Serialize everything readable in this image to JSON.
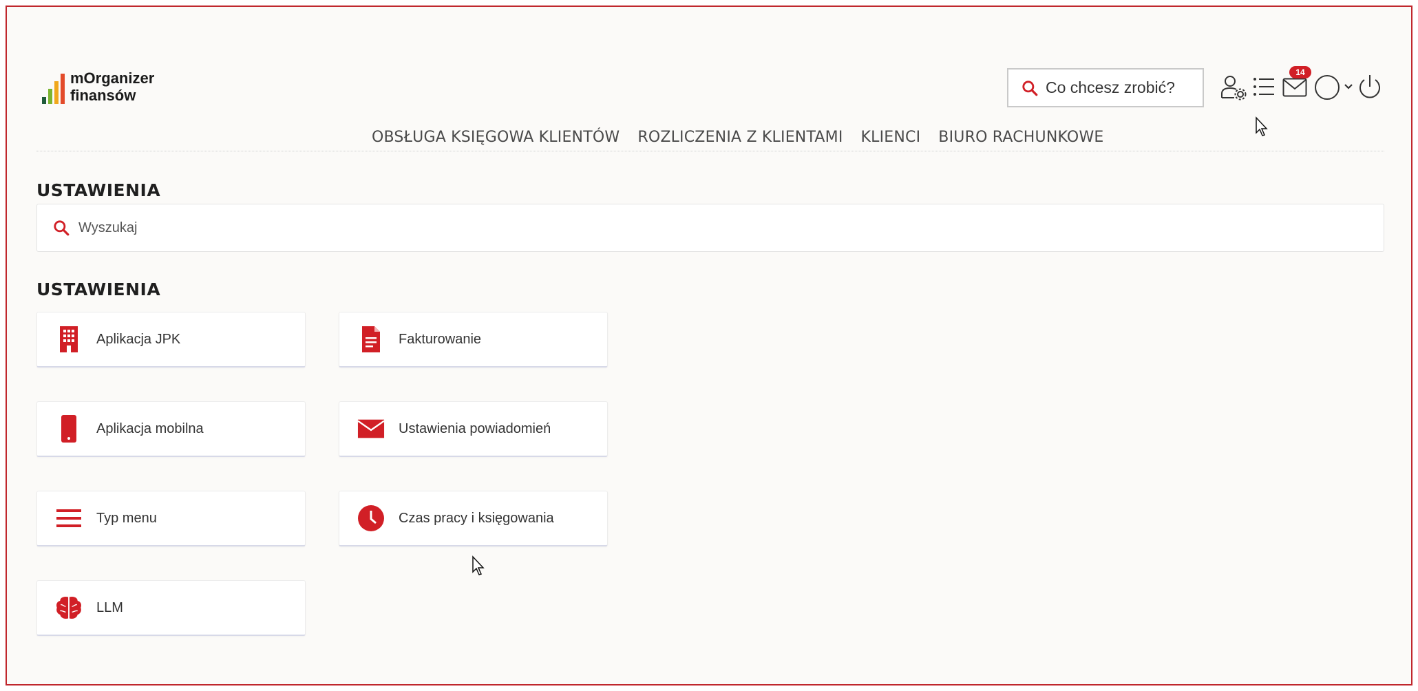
{
  "brand": {
    "line1": "mOrganizer",
    "line2": "finansów"
  },
  "header": {
    "quick_search": "Co chcesz zrobić?",
    "notifications_count": "14"
  },
  "nav": {
    "items": [
      {
        "label": "OBSŁUGA KSIĘGOWA KLIENTÓW"
      },
      {
        "label": "ROZLICZENIA Z KLIENTAMI"
      },
      {
        "label": "KLIENCI"
      },
      {
        "label": "BIURO RACHUNKOWE"
      }
    ]
  },
  "page": {
    "title": "USTAWIENIA",
    "search_placeholder": "Wyszukaj",
    "section_title": "USTAWIENIA"
  },
  "tiles": [
    {
      "label": "Aplikacja JPK",
      "icon": "building-icon"
    },
    {
      "label": "Fakturowanie",
      "icon": "document-icon"
    },
    {
      "label": "Aplikacja mobilna",
      "icon": "phone-icon"
    },
    {
      "label": "Ustawienia powiadomień",
      "icon": "envelope-icon"
    },
    {
      "label": "Typ menu",
      "icon": "menu-icon"
    },
    {
      "label": "Czas pracy i księgowania",
      "icon": "clock-icon"
    },
    {
      "label": "LLM",
      "icon": "brain-icon"
    }
  ],
  "colors": {
    "accent": "#d11f26",
    "frame": "#c0272d",
    "logo_bars": [
      "#1f5b3a",
      "#7bb531",
      "#f0a81c",
      "#e34b2a"
    ]
  }
}
